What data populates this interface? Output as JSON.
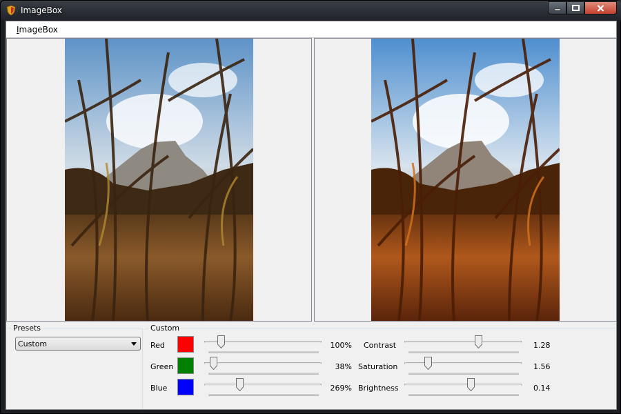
{
  "window": {
    "title": "ImageBox",
    "app_icon": "shield-icon",
    "buttons": {
      "minimize_icon": "minimize-icon",
      "maximize_icon": "maximize-icon",
      "close_icon": "close-icon"
    }
  },
  "menubar": {
    "items": [
      {
        "label": "ImageBox",
        "mnemonic": "I"
      }
    ]
  },
  "panels": {
    "original": {
      "content": "photo of a mountain seen through tall grass and reeds"
    },
    "processed": {
      "content": "same photo with stronger orange saturation"
    }
  },
  "presets": {
    "group_title": "Presets",
    "selected": "Custom"
  },
  "custom": {
    "group_title": "Custom",
    "colors": [
      {
        "label": "Red",
        "swatch": "#ff0000",
        "percent_text": "100%",
        "level": 0.12
      },
      {
        "label": "Green",
        "swatch": "#008000",
        "percent_text": "38%",
        "level": 0.05
      },
      {
        "label": "Blue",
        "swatch": "#0000ff",
        "percent_text": "269%",
        "level": 0.29
      }
    ],
    "adjustments": [
      {
        "label": "Contrast",
        "value_text": "1.28",
        "level": 0.64
      },
      {
        "label": "Saturation",
        "value_text": "1.56",
        "level": 0.18
      },
      {
        "label": "Brightness",
        "value_text": "0.14",
        "level": 0.57
      }
    ]
  }
}
